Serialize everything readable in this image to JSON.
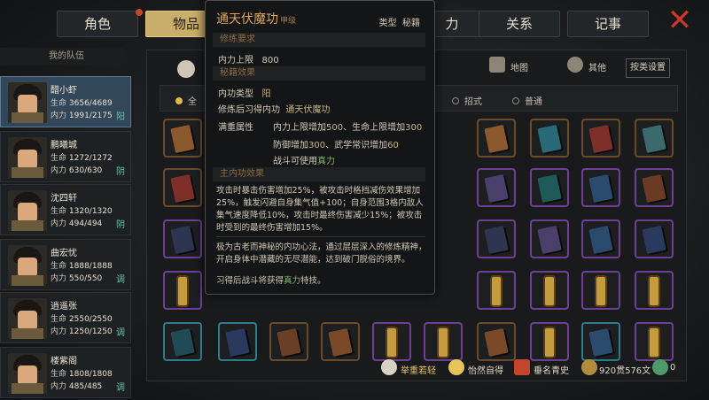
{
  "tabs": [
    {
      "label": "角色",
      "badge": true
    },
    {
      "label": "物品",
      "active": true
    },
    {
      "label": "力"
    },
    {
      "label": "关系"
    },
    {
      "label": "记事"
    }
  ],
  "close_label": "✕",
  "team_label": "我的队伍",
  "characters": [
    {
      "name": "醋小虾",
      "hp_label": "生命",
      "hp": "3656/4689",
      "mp_label": "内力",
      "mp": "1991/2175",
      "tag": "阳",
      "active": true
    },
    {
      "name": "鹏曦城",
      "hp_label": "生命",
      "hp": "1272/1272",
      "mp_label": "内力",
      "mp": "630/630",
      "tag": "阴"
    },
    {
      "name": "沈四轩",
      "hp_label": "生命",
      "hp": "1320/1320",
      "mp_label": "内力",
      "mp": "494/494",
      "tag": "阴"
    },
    {
      "name": "曲宏忧",
      "hp_label": "生命",
      "hp": "1888/1888",
      "mp_label": "内力",
      "mp": "550/550",
      "tag": "调"
    },
    {
      "name": "逍遥张",
      "hp_label": "生命",
      "hp": "2550/2550",
      "mp_label": "内力",
      "mp": "1250/1250",
      "tag": "调"
    },
    {
      "name": "楼紫阁",
      "hp_label": "生命",
      "hp": "1808/1808",
      "mp_label": "内力",
      "mp": "485/485",
      "tag": "调"
    }
  ],
  "inventory": {
    "subtabs": [
      "地图",
      "其他"
    ],
    "sort_button": "按类设置",
    "filters": [
      "全",
      "招式",
      "普通"
    ]
  },
  "status": {
    "items": [
      "举重若轻",
      "怡然自得",
      "垂名青史",
      "920贯576文",
      "0"
    ]
  },
  "tooltip": {
    "title": "通天伏魔功",
    "grade": "甲级",
    "type_label": "类型",
    "type_value": "秘籍",
    "req_section": "修练要求",
    "req_label": "内力上限",
    "req_value": "800",
    "effect_section": "秘籍效果",
    "neigong_type_label": "内功类型",
    "neigong_type_value": "阳",
    "after_label": "修炼后习得内功",
    "after_value": "通天伏魔功",
    "full_label": "满重属性",
    "full_1a": "内力上限增加",
    "full_1a_v": "500",
    "full_1b": "、生命上限增加",
    "full_1b_v": "300",
    "full_2a": "防御增加",
    "full_2a_v": "300",
    "full_2b": "、武学常识增加",
    "full_2b_v": "60",
    "full_3a": "战斗可使用",
    "full_3a_v": "真力",
    "main_section": "主内功效果",
    "main_text": "攻击时暴击伤害增加25%，被攻击时格挡减伤效果增加25%，触发闪避自身集气值+100；自身范围3格内敌人集气速度降低10%，攻击时最终伤害减少15%；被攻击时受到的最终伤害增加15%。",
    "desc_text": "极为古老而神秘的内功心法，通过层层深入的修炼精神，开启身体中潜藏的无尽潜能，达到破门脱俗的境界。",
    "note_a": "习得后战斗将获得",
    "note_v": "真力",
    "note_b": "特技。"
  }
}
